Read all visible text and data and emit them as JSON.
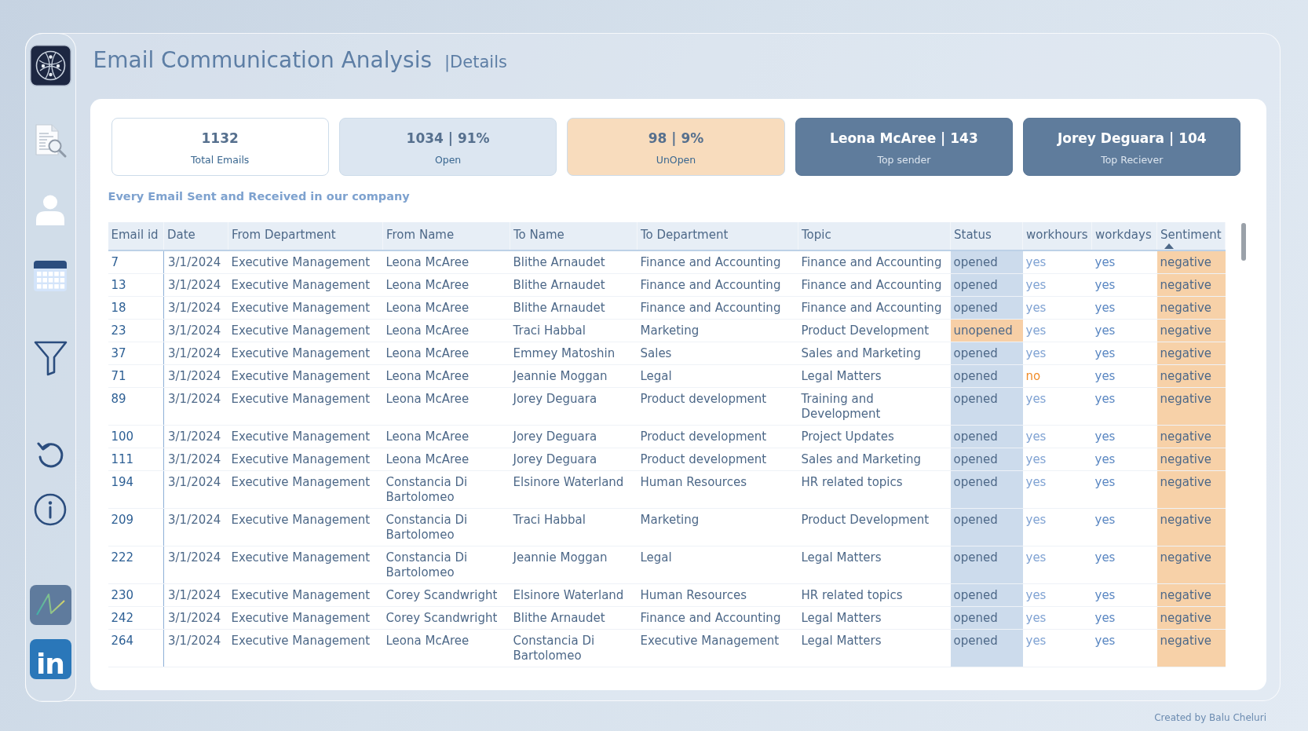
{
  "header": {
    "title": "Email Communication Analysis",
    "subtitle": "|Details"
  },
  "sidebar": {
    "social_label": "in"
  },
  "kpis": [
    {
      "value": "1132",
      "label": "Total Emails",
      "color": "#ffffff"
    },
    {
      "value": "1034 | 91%",
      "label": "Open",
      "color": "#dce6f1"
    },
    {
      "value": "98 | 9%",
      "label": "UnOpen",
      "color": "#f8dcbd"
    },
    {
      "value": "Leona McAree | 143",
      "label": "Top sender",
      "color": "#5f7c9c"
    },
    {
      "value": "Jorey Deguara | 104",
      "label": "Top Reciever",
      "color": "#5f7c9c"
    }
  ],
  "table": {
    "title": "Every Email Sent and Received in our company",
    "columns": [
      {
        "label": "Email id",
        "sorted": false
      },
      {
        "label": "Date",
        "sorted": false
      },
      {
        "label": "From Department",
        "sorted": false
      },
      {
        "label": "From Name",
        "sorted": false
      },
      {
        "label": "To Name",
        "sorted": false
      },
      {
        "label": "To Department",
        "sorted": false
      },
      {
        "label": "Topic",
        "sorted": false
      },
      {
        "label": "Status",
        "sorted": false
      },
      {
        "label": "workhours",
        "sorted": false
      },
      {
        "label": "workdays",
        "sorted": false
      },
      {
        "label": "Sentiment",
        "sorted": true
      }
    ],
    "rows": [
      {
        "email_id": "7",
        "date": "3/1/2024",
        "from_department": "Executive Management",
        "from_name": "Leona McAree",
        "to_name": "Blithe Arnaudet",
        "to_department": "Finance and Accounting",
        "topic": "Finance and Accounting",
        "status": {
          "text": "opened",
          "opened": true
        },
        "workhours": {
          "text": "yes",
          "on": true
        },
        "workdays": {
          "text": "yes",
          "on": true
        },
        "sentiment": {
          "text": "negative",
          "negative": true
        }
      },
      {
        "email_id": "13",
        "date": "3/1/2024",
        "from_department": "Executive Management",
        "from_name": "Leona McAree",
        "to_name": "Blithe Arnaudet",
        "to_department": "Finance and Accounting",
        "topic": "Finance and Accounting",
        "status": {
          "text": "opened",
          "opened": true
        },
        "workhours": {
          "text": "yes",
          "on": true
        },
        "workdays": {
          "text": "yes",
          "on": true
        },
        "sentiment": {
          "text": "negative",
          "negative": true
        }
      },
      {
        "email_id": "18",
        "date": "3/1/2024",
        "from_department": "Executive Management",
        "from_name": "Leona McAree",
        "to_name": "Blithe Arnaudet",
        "to_department": "Finance and Accounting",
        "topic": "Finance and Accounting",
        "status": {
          "text": "opened",
          "opened": true
        },
        "workhours": {
          "text": "yes",
          "on": true
        },
        "workdays": {
          "text": "yes",
          "on": true
        },
        "sentiment": {
          "text": "negative",
          "negative": true
        }
      },
      {
        "email_id": "23",
        "date": "3/1/2024",
        "from_department": "Executive Management",
        "from_name": "Leona McAree",
        "to_name": "Traci Habbal",
        "to_department": "Marketing",
        "topic": "Product Development",
        "status": {
          "text": "unopened",
          "opened": false
        },
        "workhours": {
          "text": "yes",
          "on": true
        },
        "workdays": {
          "text": "yes",
          "on": true
        },
        "sentiment": {
          "text": "negative",
          "negative": true
        }
      },
      {
        "email_id": "37",
        "date": "3/1/2024",
        "from_department": "Executive Management",
        "from_name": "Leona McAree",
        "to_name": "Emmey Matoshin",
        "to_department": "Sales",
        "topic": "Sales and Marketing",
        "status": {
          "text": "opened",
          "opened": true
        },
        "workhours": {
          "text": "yes",
          "on": true
        },
        "workdays": {
          "text": "yes",
          "on": true
        },
        "sentiment": {
          "text": "negative",
          "negative": true
        }
      },
      {
        "email_id": "71",
        "date": "3/1/2024",
        "from_department": "Executive Management",
        "from_name": "Leona McAree",
        "to_name": "Jeannie Moggan",
        "to_department": "Legal",
        "topic": "Legal Matters",
        "status": {
          "text": "opened",
          "opened": true
        },
        "workhours": {
          "text": "no",
          "on": false
        },
        "workdays": {
          "text": "yes",
          "on": true
        },
        "sentiment": {
          "text": "negative",
          "negative": true
        }
      },
      {
        "email_id": "89",
        "date": "3/1/2024",
        "from_department": "Executive Management",
        "from_name": "Leona McAree",
        "to_name": "Jorey Deguara",
        "to_department": "Product development",
        "topic": "Training and Development",
        "status": {
          "text": "opened",
          "opened": true
        },
        "workhours": {
          "text": "yes",
          "on": true
        },
        "workdays": {
          "text": "yes",
          "on": true
        },
        "sentiment": {
          "text": "negative",
          "negative": true
        }
      },
      {
        "email_id": "100",
        "date": "3/1/2024",
        "from_department": "Executive Management",
        "from_name": "Leona McAree",
        "to_name": "Jorey Deguara",
        "to_department": "Product development",
        "topic": "Project Updates",
        "status": {
          "text": "opened",
          "opened": true
        },
        "workhours": {
          "text": "yes",
          "on": true
        },
        "workdays": {
          "text": "yes",
          "on": true
        },
        "sentiment": {
          "text": "negative",
          "negative": true
        }
      },
      {
        "email_id": "111",
        "date": "3/1/2024",
        "from_department": "Executive Management",
        "from_name": "Leona McAree",
        "to_name": "Jorey Deguara",
        "to_department": "Product development",
        "topic": "Sales and Marketing",
        "status": {
          "text": "opened",
          "opened": true
        },
        "workhours": {
          "text": "yes",
          "on": true
        },
        "workdays": {
          "text": "yes",
          "on": true
        },
        "sentiment": {
          "text": "negative",
          "negative": true
        }
      },
      {
        "email_id": "194",
        "date": "3/1/2024",
        "from_department": "Executive Management",
        "from_name": "Constancia Di Bartolomeo",
        "to_name": "Elsinore Waterland",
        "to_department": "Human Resources",
        "topic": "HR related topics",
        "status": {
          "text": "opened",
          "opened": true
        },
        "workhours": {
          "text": "yes",
          "on": true
        },
        "workdays": {
          "text": "yes",
          "on": true
        },
        "sentiment": {
          "text": "negative",
          "negative": true
        }
      },
      {
        "email_id": "209",
        "date": "3/1/2024",
        "from_department": "Executive Management",
        "from_name": "Constancia Di Bartolomeo",
        "to_name": "Traci Habbal",
        "to_department": "Marketing",
        "topic": "Product Development",
        "status": {
          "text": "opened",
          "opened": true
        },
        "workhours": {
          "text": "yes",
          "on": true
        },
        "workdays": {
          "text": "yes",
          "on": true
        },
        "sentiment": {
          "text": "negative",
          "negative": true
        }
      },
      {
        "email_id": "222",
        "date": "3/1/2024",
        "from_department": "Executive Management",
        "from_name": "Constancia Di Bartolomeo",
        "to_name": "Jeannie Moggan",
        "to_department": "Legal",
        "topic": "Legal Matters",
        "status": {
          "text": "opened",
          "opened": true
        },
        "workhours": {
          "text": "yes",
          "on": true
        },
        "workdays": {
          "text": "yes",
          "on": true
        },
        "sentiment": {
          "text": "negative",
          "negative": true
        }
      },
      {
        "email_id": "230",
        "date": "3/1/2024",
        "from_department": "Executive Management",
        "from_name": "Corey Scandwright",
        "to_name": "Elsinore Waterland",
        "to_department": "Human Resources",
        "topic": "HR related topics",
        "status": {
          "text": "opened",
          "opened": true
        },
        "workhours": {
          "text": "yes",
          "on": true
        },
        "workdays": {
          "text": "yes",
          "on": true
        },
        "sentiment": {
          "text": "negative",
          "negative": true
        }
      },
      {
        "email_id": "242",
        "date": "3/1/2024",
        "from_department": "Executive Management",
        "from_name": "Corey Scandwright",
        "to_name": "Blithe Arnaudet",
        "to_department": "Finance and Accounting",
        "topic": "Legal Matters",
        "status": {
          "text": "opened",
          "opened": true
        },
        "workhours": {
          "text": "yes",
          "on": true
        },
        "workdays": {
          "text": "yes",
          "on": true
        },
        "sentiment": {
          "text": "negative",
          "negative": true
        }
      },
      {
        "email_id": "264",
        "date": "3/1/2024",
        "from_department": "Executive Management",
        "from_name": "Leona McAree",
        "to_name": "Constancia Di Bartolomeo",
        "to_department": "Executive Management",
        "topic": "Legal Matters",
        "status": {
          "text": "opened",
          "opened": true
        },
        "workhours": {
          "text": "yes",
          "on": true
        },
        "workdays": {
          "text": "yes",
          "on": true
        },
        "sentiment": {
          "text": "negative",
          "negative": true
        }
      }
    ]
  },
  "footer": {
    "credit": "Created by Balu Cheluri"
  }
}
